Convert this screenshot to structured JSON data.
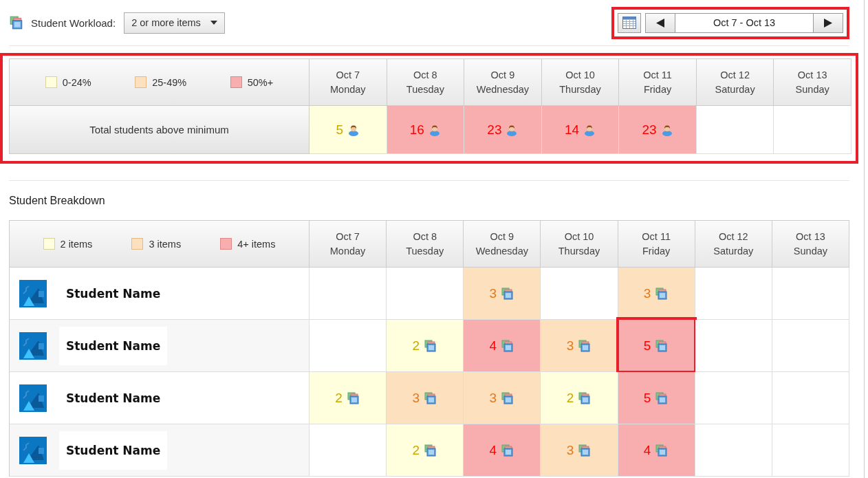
{
  "toolbar": {
    "label": "Student Workload:",
    "filter": {
      "value": "2 or more items"
    },
    "date_nav": {
      "range": "Oct 7 - Oct 13",
      "highlighted": true
    }
  },
  "summary": {
    "highlighted": true,
    "legend": [
      {
        "label": "0-24%",
        "color": "#ffffdd"
      },
      {
        "label": "25-49%",
        "color": "#fde0bd"
      },
      {
        "label": "50%+",
        "color": "#f8aeae"
      }
    ],
    "days": [
      {
        "date": "Oct 7",
        "weekday": "Monday"
      },
      {
        "date": "Oct 8",
        "weekday": "Tuesday"
      },
      {
        "date": "Oct 9",
        "weekday": "Wednesday"
      },
      {
        "date": "Oct 10",
        "weekday": "Thursday"
      },
      {
        "date": "Oct 11",
        "weekday": "Friday"
      },
      {
        "date": "Oct 12",
        "weekday": "Saturday"
      },
      {
        "date": "Oct 13",
        "weekday": "Sunday"
      }
    ],
    "row_label": "Total students above minimum",
    "cells": [
      {
        "value": "5",
        "color": "#ffffdd"
      },
      {
        "value": "16",
        "color": "#f8aeae"
      },
      {
        "value": "23",
        "color": "#f8aeae"
      },
      {
        "value": "14",
        "color": "#f8aeae"
      },
      {
        "value": "23",
        "color": "#f8aeae"
      },
      {},
      {}
    ]
  },
  "breakdown": {
    "title": "Student Breakdown",
    "legend": [
      {
        "label": "2 items",
        "color": "#ffffdd"
      },
      {
        "label": "3 items",
        "color": "#fde0bd"
      },
      {
        "label": "4+ items",
        "color": "#f8aeae"
      }
    ],
    "days": [
      {
        "date": "Oct 7",
        "weekday": "Monday"
      },
      {
        "date": "Oct 8",
        "weekday": "Tuesday"
      },
      {
        "date": "Oct 9",
        "weekday": "Wednesday"
      },
      {
        "date": "Oct 10",
        "weekday": "Thursday"
      },
      {
        "date": "Oct 11",
        "weekday": "Friday"
      },
      {
        "date": "Oct 12",
        "weekday": "Saturday"
      },
      {
        "date": "Oct 13",
        "weekday": "Sunday"
      }
    ],
    "rows": [
      {
        "name": "Student Name",
        "cells": [
          {},
          {},
          {
            "value": "3",
            "color": "#fde0bd"
          },
          {},
          {
            "value": "3",
            "color": "#fde0bd"
          },
          {},
          {}
        ]
      },
      {
        "name": "Student Name",
        "cells": [
          {},
          {
            "value": "2",
            "color": "#ffffdd"
          },
          {
            "value": "4",
            "color": "#f8aeae"
          },
          {
            "value": "3",
            "color": "#fde0bd"
          },
          {
            "value": "5",
            "color": "#f8aeae",
            "highlighted": true
          },
          {},
          {}
        ]
      },
      {
        "name": "Student Name",
        "cells": [
          {
            "value": "2",
            "color": "#ffffdd"
          },
          {
            "value": "3",
            "color": "#fde0bd"
          },
          {
            "value": "3",
            "color": "#fde0bd"
          },
          {
            "value": "2",
            "color": "#ffffdd"
          },
          {
            "value": "5",
            "color": "#f8aeae"
          },
          {},
          {}
        ]
      },
      {
        "name": "Student Name",
        "cells": [
          {},
          {
            "value": "2",
            "color": "#ffffdd"
          },
          {
            "value": "4",
            "color": "#f8aeae"
          },
          {
            "value": "3",
            "color": "#fde0bd"
          },
          {
            "value": "4",
            "color": "#f8aeae"
          },
          {},
          {}
        ]
      }
    ]
  }
}
